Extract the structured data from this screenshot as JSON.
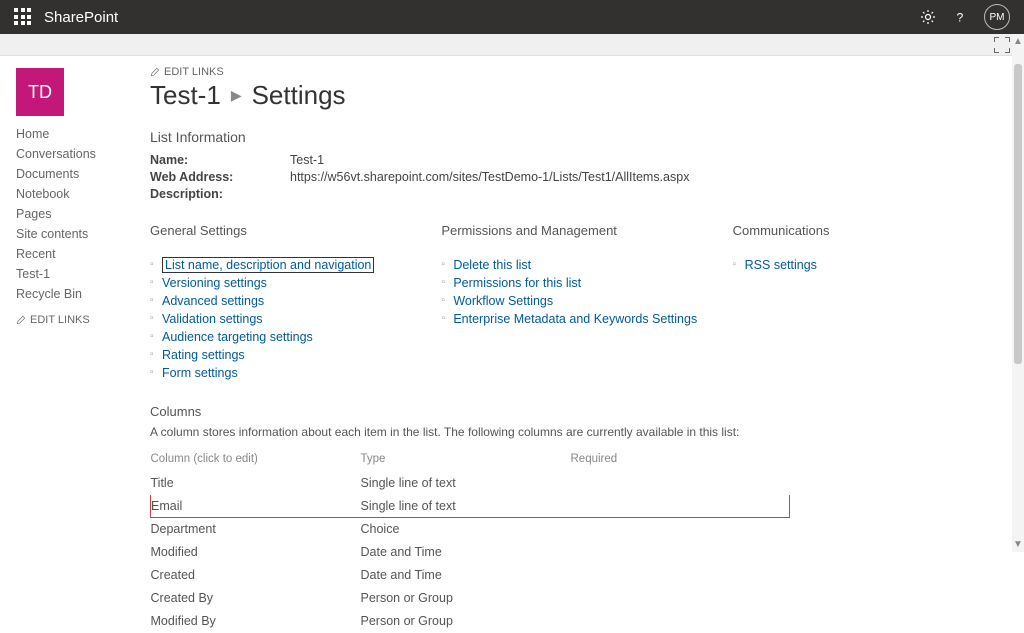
{
  "topbar": {
    "product": "SharePoint",
    "avatar_initials": "PM"
  },
  "site": {
    "logo_text": "TD",
    "edit_links": "EDIT LINKS"
  },
  "breadcrumb": {
    "site_name": "Test-1",
    "page": "Settings"
  },
  "sidebar": {
    "items": [
      "Home",
      "Conversations",
      "Documents",
      "Notebook",
      "Pages",
      "Site contents",
      "Recent",
      "Test-1",
      "Recycle Bin"
    ],
    "edit_links": "EDIT LINKS"
  },
  "list_info": {
    "heading": "List Information",
    "name_label": "Name:",
    "name_value": "Test-1",
    "address_label": "Web Address:",
    "address_value": "https://w56vt.sharepoint.com/sites/TestDemo-1/Lists/Test1/AllItems.aspx",
    "description_label": "Description:",
    "description_value": ""
  },
  "settings_sections": {
    "general": {
      "title": "General Settings",
      "links": [
        "List name, description and navigation",
        "Versioning settings",
        "Advanced settings",
        "Validation settings",
        "Audience targeting settings",
        "Rating settings",
        "Form settings"
      ]
    },
    "permissions": {
      "title": "Permissions and Management",
      "links": [
        "Delete this list",
        "Permissions for this list",
        "Workflow Settings",
        "Enterprise Metadata and Keywords Settings"
      ]
    },
    "communications": {
      "title": "Communications",
      "links": [
        "RSS settings"
      ]
    }
  },
  "columns": {
    "heading": "Columns",
    "intro": "A column stores information about each item in the list. The following columns are currently available in this list:",
    "headers": {
      "col": "Column (click to edit)",
      "type": "Type",
      "req": "Required"
    },
    "rows": [
      {
        "name": "Title",
        "type": "Single line of text",
        "required": "",
        "highlight": false
      },
      {
        "name": "Email",
        "type": "Single line of text",
        "required": "",
        "highlight": true
      },
      {
        "name": "Department",
        "type": "Choice",
        "required": "",
        "highlight": false
      },
      {
        "name": "Modified",
        "type": "Date and Time",
        "required": "",
        "highlight": false
      },
      {
        "name": "Created",
        "type": "Date and Time",
        "required": "",
        "highlight": false
      },
      {
        "name": "Created By",
        "type": "Person or Group",
        "required": "",
        "highlight": false
      },
      {
        "name": "Modified By",
        "type": "Person or Group",
        "required": "",
        "highlight": false
      }
    ]
  }
}
